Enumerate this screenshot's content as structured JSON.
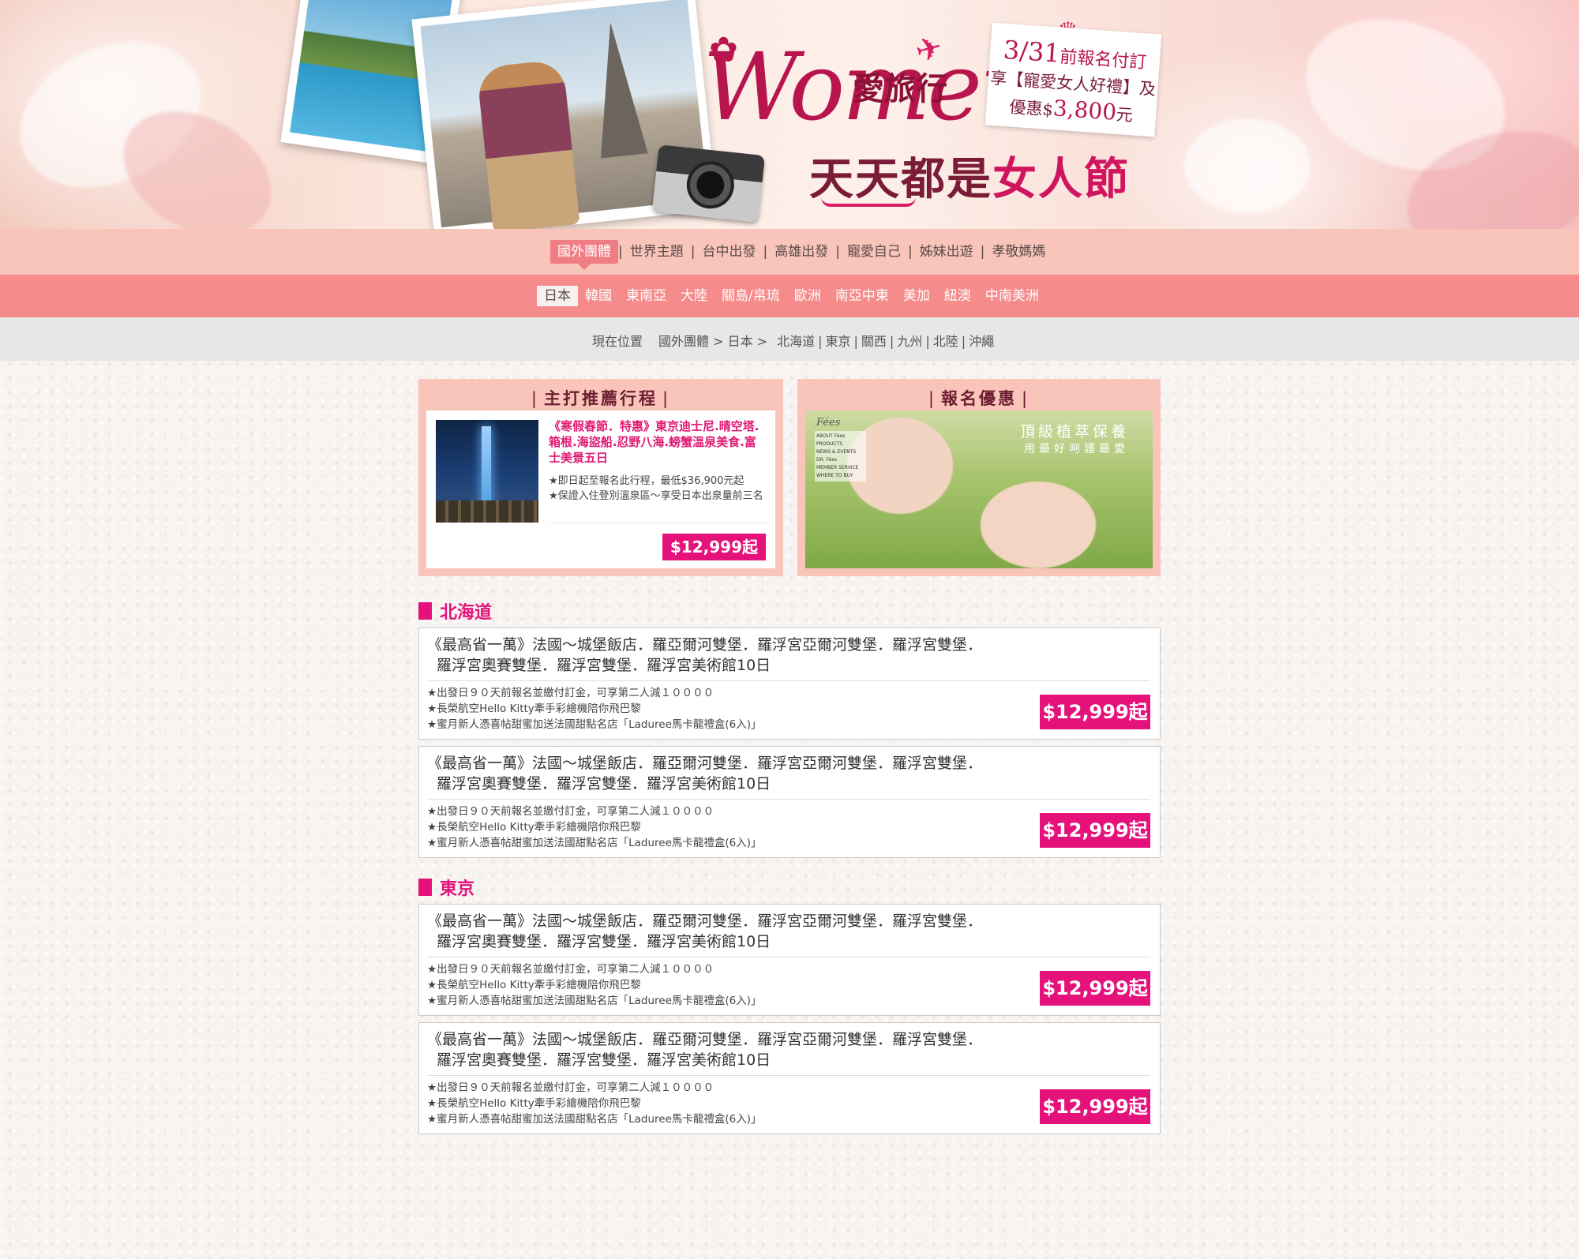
{
  "banner": {
    "logo_women": "Women",
    "logo_cn_top": "愛旅行",
    "logo_cn_main_a": "天天都是",
    "logo_cn_main_b": "女人節",
    "promo_date": "3/31",
    "promo_l1": "前報名付訂",
    "promo_l2": "享【寵愛女人好禮】及",
    "promo_l3a": "優惠$",
    "promo_l3b": "3,800",
    "promo_l3c": "元"
  },
  "nav_main": {
    "items": [
      "國外團體",
      "世界主題",
      "台中出發",
      "高雄出發",
      "寵愛自己",
      "姊妹出遊",
      "孝敬媽媽"
    ],
    "active_index": 0
  },
  "nav_region": {
    "items": [
      "日本",
      "韓國",
      "東南亞",
      "大陸",
      "關島/帛琉",
      "歐洲",
      "南亞中東",
      "美加",
      "紐澳",
      "中南美洲"
    ],
    "active_index": 0
  },
  "breadcrumb": {
    "label": "現在位置",
    "path": "國外團體 > 日本 >",
    "subs": [
      "北海道",
      "東京",
      "關西",
      "九州",
      "北陸",
      "沖繩"
    ]
  },
  "featured": {
    "title": "主打推薦行程",
    "rec_title": "《寒假春節．特惠》東京迪士尼.晴空塔.箱根.海盜船.忍野八海.螃蟹溫泉美食.富士美景五日",
    "rec_notes": [
      "★即日起至報名此行程，最低$36,900元起",
      "★保證入住登別溫泉區～享受日本出泉量前三名"
    ],
    "rec_price": "$12,999起"
  },
  "promo_box": {
    "title": "報名優惠",
    "ad_brand": "Fées",
    "ad_menu": [
      "ABOUT Fées",
      "PRODUCTS",
      "NEWS & EVENTS",
      "DR. Fées",
      "MEMBER SERVICE",
      "WHERE TO BUY"
    ],
    "ad_slogan1": "頂級植萃保養",
    "ad_slogan2": "用最好呵護最愛"
  },
  "sections": [
    {
      "name": "北海道",
      "cards": [
        {
          "title_l1": "《最高省一萬》法國～城堡飯店．羅亞爾河雙堡．羅浮宮亞爾河雙堡．羅浮宮雙堡．",
          "title_l2": "羅浮宮奧賽雙堡．羅浮宮雙堡．羅浮宮美術館10日",
          "notes": [
            "★出發日９０天前報名並繳付訂金，可享第二人減１００００",
            "★長榮航空Hello Kitty牽手彩繪機陪你飛巴黎",
            "★蜜月新人憑喜帖甜蜜加送法國甜點名店「Laduree馬卡龍禮盒(6入)」"
          ],
          "price": "$12,999起"
        },
        {
          "title_l1": "《最高省一萬》法國～城堡飯店．羅亞爾河雙堡．羅浮宮亞爾河雙堡．羅浮宮雙堡．",
          "title_l2": "羅浮宮奧賽雙堡．羅浮宮雙堡．羅浮宮美術館10日",
          "notes": [
            "★出發日９０天前報名並繳付訂金，可享第二人減１００００",
            "★長榮航空Hello Kitty牽手彩繪機陪你飛巴黎",
            "★蜜月新人憑喜帖甜蜜加送法國甜點名店「Laduree馬卡龍禮盒(6入)」"
          ],
          "price": "$12,999起"
        }
      ]
    },
    {
      "name": "東京",
      "cards": [
        {
          "title_l1": "《最高省一萬》法國～城堡飯店．羅亞爾河雙堡．羅浮宮亞爾河雙堡．羅浮宮雙堡．",
          "title_l2": "羅浮宮奧賽雙堡．羅浮宮雙堡．羅浮宮美術館10日",
          "notes": [
            "★出發日９０天前報名並繳付訂金，可享第二人減１００００",
            "★長榮航空Hello Kitty牽手彩繪機陪你飛巴黎",
            "★蜜月新人憑喜帖甜蜜加送法國甜點名店「Laduree馬卡龍禮盒(6入)」"
          ],
          "price": "$12,999起"
        },
        {
          "title_l1": "《最高省一萬》法國～城堡飯店．羅亞爾河雙堡．羅浮宮亞爾河雙堡．羅浮宮雙堡．",
          "title_l2": "羅浮宮奧賽雙堡．羅浮宮雙堡．羅浮宮美術館10日",
          "notes": [
            "★出發日９０天前報名並繳付訂金，可享第二人減１００００",
            "★長榮航空Hello Kitty牽手彩繪機陪你飛巴黎",
            "★蜜月新人憑喜帖甜蜜加送法國甜點名店「Laduree馬卡龍禮盒(6入)」"
          ],
          "price": "$12,999起"
        }
      ]
    }
  ],
  "colors": {
    "accent": "#e4127a",
    "nav_main_bg": "#f9c4b9",
    "nav_region_bg": "#f58b8b",
    "breadcrumb_bg": "#e8e6e6"
  }
}
